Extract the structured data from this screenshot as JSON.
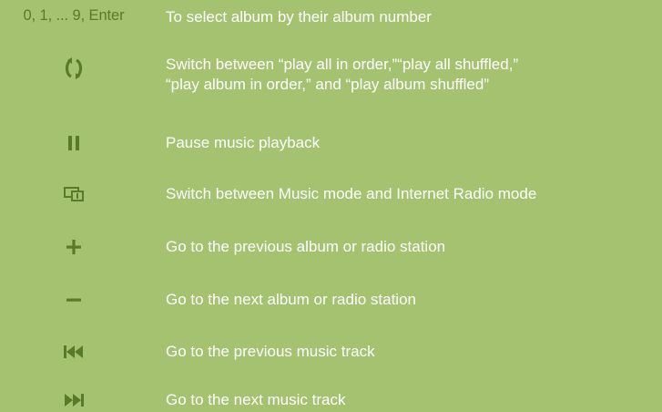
{
  "colors": {
    "background": "#a4c270",
    "icon": "#5a7a2b",
    "text": "#ffffff"
  },
  "rows": [
    {
      "key": "0, 1, ... 9, Enter",
      "icon": null,
      "line1": "To select album by their album number",
      "line2": ""
    },
    {
      "key": "",
      "icon": "repeat-shuffle-icon",
      "line1": "Switch between “play all in order,”“play all shuffled,”",
      "line2": "“play album in order,” and “play album shuffled”"
    },
    {
      "key": "",
      "icon": "pause-icon",
      "line1": "Pause music playback",
      "line2": ""
    },
    {
      "key": "",
      "icon": "mode-switch-icon",
      "line1": "Switch between Music mode and Internet Radio mode",
      "line2": ""
    },
    {
      "key": "",
      "icon": "plus-icon",
      "line1": "Go to the previous album or radio station",
      "line2": ""
    },
    {
      "key": "",
      "icon": "minus-icon",
      "line1": "Go to the next album or radio station",
      "line2": ""
    },
    {
      "key": "",
      "icon": "previous-track-icon",
      "line1": "Go to the previous music track",
      "line2": ""
    },
    {
      "key": "",
      "icon": "next-track-icon",
      "line1": "Go to the next music track",
      "line2": ""
    }
  ]
}
